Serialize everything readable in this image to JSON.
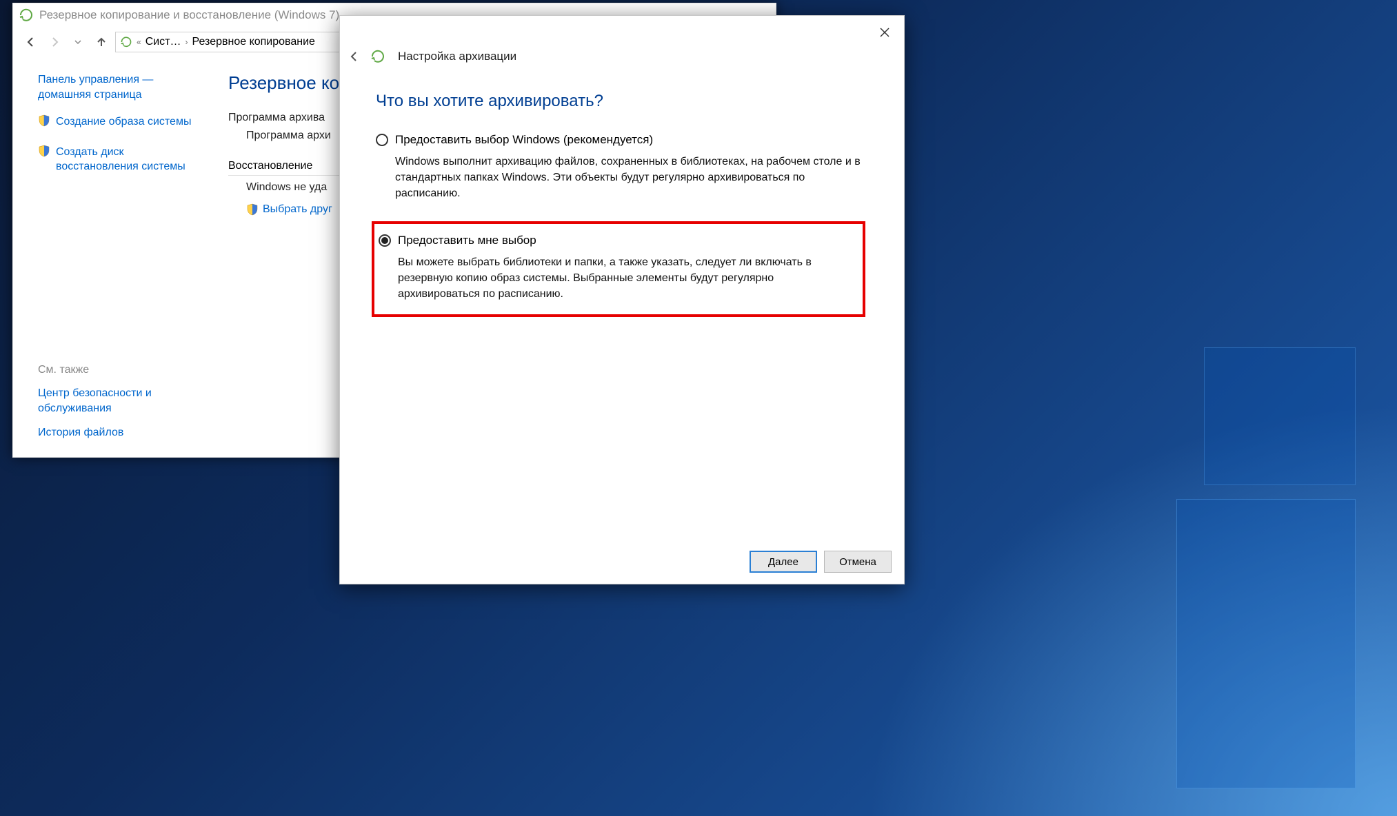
{
  "explorer": {
    "title": "Резервное копирование и восстановление (Windows 7)",
    "breadcrumbs": {
      "item1": "Сист…",
      "item2": "Резервное копирование"
    },
    "sidebar": {
      "home": "Панель управления — домашняя страница",
      "createImage": "Создание образа системы",
      "createDisc": "Создать диск восстановления системы",
      "seeAlso": "См. также",
      "security": "Центр безопасности и обслуживания",
      "history": "История файлов"
    },
    "main": {
      "title": "Резервное коп",
      "line1": "Программа архива",
      "line2": "Программа архи",
      "restoreHeader": "Восстановление",
      "restoreLine": "Windows не уда",
      "chooseLink": "Выбрать друг"
    }
  },
  "wizard": {
    "header": "Настройка архивации",
    "question": "Что вы хотите архивировать?",
    "option1": {
      "label": "Предоставить выбор Windows (рекомендуется)",
      "desc": "Windows выполнит архивацию файлов, сохраненных в библиотеках, на рабочем столе и в стандартных папках Windows. Эти объекты будут регулярно архивироваться по расписанию."
    },
    "option2": {
      "label": "Предоставить мне выбор",
      "desc": "Вы можете выбрать библиотеки и папки, а также указать, следует ли включать в резервную копию образ системы. Выбранные элементы будут регулярно архивироваться по расписанию."
    },
    "buttons": {
      "next": "Далее",
      "cancel": "Отмена"
    }
  }
}
